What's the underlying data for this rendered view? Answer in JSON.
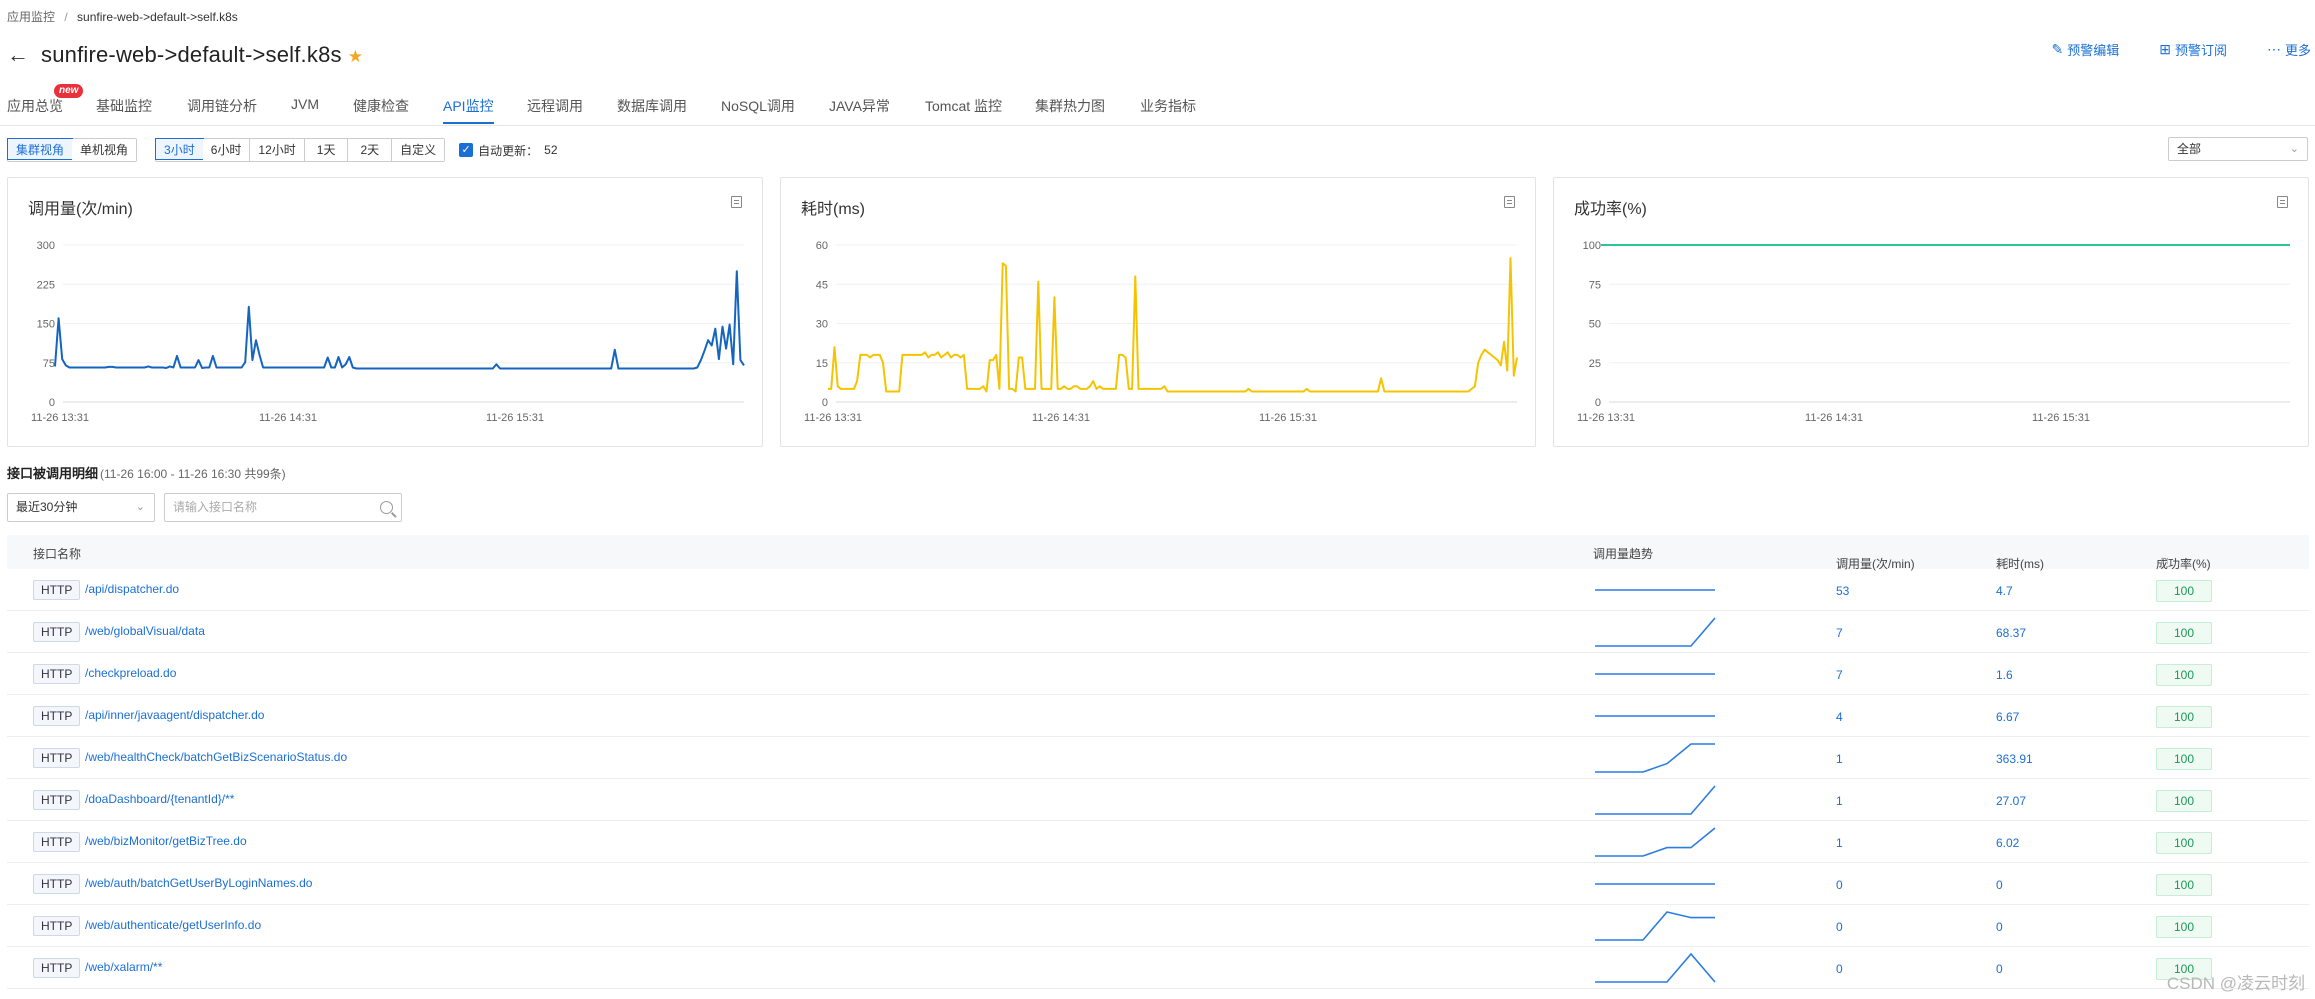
{
  "breadcrumb": [
    "应用监控",
    "/",
    "sunfire-web->default->self.k8s"
  ],
  "title": "sunfire-web->default->self.k8s",
  "actions": [
    {
      "icon": "edit-icon",
      "label": "预警编辑"
    },
    {
      "icon": "subscribe-icon",
      "label": "预警订阅"
    },
    {
      "icon": "more-icon",
      "label": "更多"
    }
  ],
  "tabs": [
    "应用总览",
    "基础监控",
    "调用链分析",
    "JVM",
    "健康检查",
    "API监控",
    "远程调用",
    "数据库调用",
    "NoSQL调用",
    "JAVA异常",
    "Tomcat 监控",
    "集群热力图",
    "业务指标"
  ],
  "active_tab": "API监控",
  "new_badge": "new",
  "view_toggle": [
    "集群视角",
    "单机视角"
  ],
  "time_ranges": [
    "3小时",
    "6小时",
    "12小时",
    "1天",
    "2天",
    "自定义"
  ],
  "auto_refresh": {
    "label": "自动更新：",
    "count": "52"
  },
  "filter_select": "全部",
  "chart_data": [
    {
      "type": "line",
      "title": "调用量(次/min)",
      "ylim": [
        0,
        300
      ],
      "yticks": [
        "300",
        "225",
        "150",
        "75",
        "0"
      ],
      "xticks": [
        "11-26 13:31",
        "11-26 14:31",
        "11-26 15:31"
      ],
      "color": "#1565c0",
      "values": [
        68,
        160,
        82,
        70,
        66,
        66,
        66,
        66,
        66,
        66,
        66,
        66,
        66,
        66,
        66,
        67,
        67,
        66,
        66,
        66,
        66,
        66,
        66,
        66,
        66,
        66,
        68,
        66,
        66,
        66,
        66,
        65,
        68,
        66,
        88,
        66,
        66,
        66,
        66,
        66,
        80,
        65,
        66,
        66,
        88,
        66,
        66,
        66,
        66,
        66,
        66,
        66,
        66,
        76,
        182,
        80,
        118,
        90,
        66,
        66,
        66,
        66,
        66,
        66,
        66,
        66,
        66,
        66,
        66,
        66,
        66,
        66,
        66,
        66,
        66,
        66,
        85,
        66,
        66,
        86,
        66,
        72,
        86,
        66,
        64,
        64,
        64,
        64,
        64,
        64,
        64,
        64,
        64,
        64,
        64,
        64,
        64,
        64,
        64,
        64,
        64,
        64,
        64,
        64,
        64,
        64,
        64,
        64,
        64,
        64,
        64,
        64,
        64,
        64,
        64,
        64,
        64,
        64,
        64,
        64,
        64,
        64,
        64,
        72,
        64,
        64,
        64,
        64,
        64,
        64,
        64,
        64,
        64,
        64,
        64,
        64,
        64,
        64,
        64,
        64,
        64,
        64,
        64,
        64,
        64,
        64,
        64,
        64,
        64,
        64,
        64,
        64,
        64,
        64,
        64,
        64,
        100,
        64,
        64,
        64,
        64,
        64,
        64,
        64,
        64,
        64,
        64,
        64,
        64,
        64,
        64,
        64,
        64,
        64,
        64,
        64,
        64,
        64,
        64,
        66,
        80,
        98,
        118,
        108,
        140,
        82,
        144,
        102,
        148,
        72,
        250,
        80,
        70
      ]
    },
    {
      "type": "line",
      "title": "耗时(ms)",
      "ylim": [
        0,
        60
      ],
      "yticks": [
        "60",
        "45",
        "30",
        "15",
        "0"
      ],
      "xticks": [
        "11-26 13:31",
        "11-26 14:31",
        "11-26 15:31"
      ],
      "color": "#f5c400",
      "values": [
        5,
        5,
        21,
        6,
        5,
        5,
        5,
        5,
        5,
        8,
        18,
        18,
        18,
        17,
        18,
        18,
        18,
        15,
        4,
        4,
        4,
        4,
        4,
        18,
        18,
        18,
        18,
        18,
        18,
        18,
        19,
        17,
        18,
        18,
        19,
        17,
        18,
        19,
        17,
        18,
        18,
        17,
        18,
        5,
        5,
        5,
        5,
        5,
        6,
        4,
        16,
        16,
        18,
        5,
        53,
        52,
        5,
        5,
        4,
        17,
        17,
        5,
        5,
        5,
        5,
        46,
        5,
        5,
        5,
        5,
        40,
        5,
        5,
        6,
        5,
        5,
        6,
        6,
        5,
        5,
        5,
        6,
        8,
        5,
        6,
        5,
        5,
        5,
        5,
        5,
        18,
        18,
        17,
        5,
        5,
        48,
        5,
        5,
        5,
        5,
        5,
        5,
        5,
        5,
        6,
        4,
        4,
        4,
        4,
        4,
        4,
        4,
        4,
        4,
        4,
        4,
        4,
        4,
        4,
        4,
        4,
        4,
        4,
        4,
        4,
        4,
        4,
        4,
        4,
        4,
        5,
        4,
        4,
        4,
        4,
        4,
        4,
        4,
        4,
        4,
        4,
        4,
        4,
        4,
        4,
        4,
        4,
        4,
        5,
        4,
        4,
        4,
        4,
        4,
        4,
        4,
        4,
        4,
        4,
        4,
        4,
        4,
        4,
        4,
        4,
        4,
        4,
        4,
        4,
        4,
        4,
        9,
        4,
        4,
        4,
        4,
        4,
        4,
        4,
        4,
        4,
        4,
        4,
        4,
        4,
        4,
        4,
        4,
        4,
        4,
        4,
        4,
        4,
        4,
        4,
        4,
        4,
        4,
        4,
        5,
        6,
        15,
        18,
        20,
        19,
        18,
        17,
        16,
        14,
        23,
        12,
        55,
        10,
        17
      ]
    },
    {
      "type": "line",
      "title": "成功率(%)",
      "ylim": [
        0,
        100
      ],
      "yticks": [
        "100",
        "75",
        "50",
        "25",
        "0"
      ],
      "xticks": [
        "11-26 13:31",
        "11-26 14:31",
        "11-26 15:31"
      ],
      "color": "#2cc593",
      "values": [
        100,
        100,
        100,
        100,
        100,
        100,
        100,
        100,
        100,
        100,
        100,
        100,
        100,
        100,
        100,
        100,
        100,
        100,
        100,
        100,
        100
      ]
    }
  ],
  "detail": {
    "title": "接口被调用明细",
    "subtitle": "(11-26 16:00 - 11-26 16:30 共99条)",
    "range_select": "最近30分钟",
    "search_placeholder": "请输入接口名称"
  },
  "table": {
    "headers": [
      "接口名称",
      "调用量趋势",
      "调用量(次/min)",
      "耗时(ms)",
      "成功率(%)"
    ],
    "rows": [
      {
        "type": "HTTP",
        "name": "/api/dispatcher.do",
        "calls": "53",
        "cost": "4.7",
        "rate": "100",
        "trend": [
          0.5,
          0.5,
          0.5,
          0.5,
          0.5,
          0.5
        ]
      },
      {
        "type": "HTTP",
        "name": "/web/globalVisual/data",
        "calls": "7",
        "cost": "68.37",
        "rate": "100",
        "trend": [
          0,
          0,
          0,
          0,
          0,
          1
        ]
      },
      {
        "type": "HTTP",
        "name": "/checkpreload.do",
        "calls": "7",
        "cost": "1.6",
        "rate": "100",
        "trend": [
          0.5,
          0.5,
          0.5,
          0.5,
          0.5,
          0.5
        ]
      },
      {
        "type": "HTTP",
        "name": "/api/inner/javaagent/dispatcher.do",
        "calls": "4",
        "cost": "6.67",
        "rate": "100",
        "trend": [
          0.5,
          0.5,
          0.5,
          0.5,
          0.5,
          0.5
        ]
      },
      {
        "type": "HTTP",
        "name": "/web/healthCheck/batchGetBizScenarioStatus.do",
        "calls": "1",
        "cost": "363.91",
        "rate": "100",
        "trend": [
          0,
          0,
          0,
          0.3,
          1,
          1
        ]
      },
      {
        "type": "HTTP",
        "name": "/doaDashboard/{tenantId}/**",
        "calls": "1",
        "cost": "27.07",
        "rate": "100",
        "trend": [
          0,
          0,
          0,
          0,
          0,
          1
        ]
      },
      {
        "type": "HTTP",
        "name": "/web/bizMonitor/getBizTree.do",
        "calls": "1",
        "cost": "6.02",
        "rate": "100",
        "trend": [
          0,
          0,
          0,
          0.3,
          0.3,
          1
        ]
      },
      {
        "type": "HTTP",
        "name": "/web/auth/batchGetUserByLoginNames.do",
        "calls": "0",
        "cost": "0",
        "rate": "100",
        "trend": [
          0.5,
          0.5,
          0.5,
          0.5,
          0.5,
          0.5
        ]
      },
      {
        "type": "HTTP",
        "name": "/web/authenticate/getUserInfo.do",
        "calls": "0",
        "cost": "0",
        "rate": "100",
        "trend": [
          0,
          0,
          0,
          1,
          0.8,
          0.8
        ]
      },
      {
        "type": "HTTP",
        "name": "/web/xalarm/**",
        "calls": "0",
        "cost": "0",
        "rate": "100",
        "trend": [
          0,
          0,
          0,
          0,
          1,
          0
        ]
      }
    ]
  },
  "watermark": "CSDN @凌云时刻"
}
